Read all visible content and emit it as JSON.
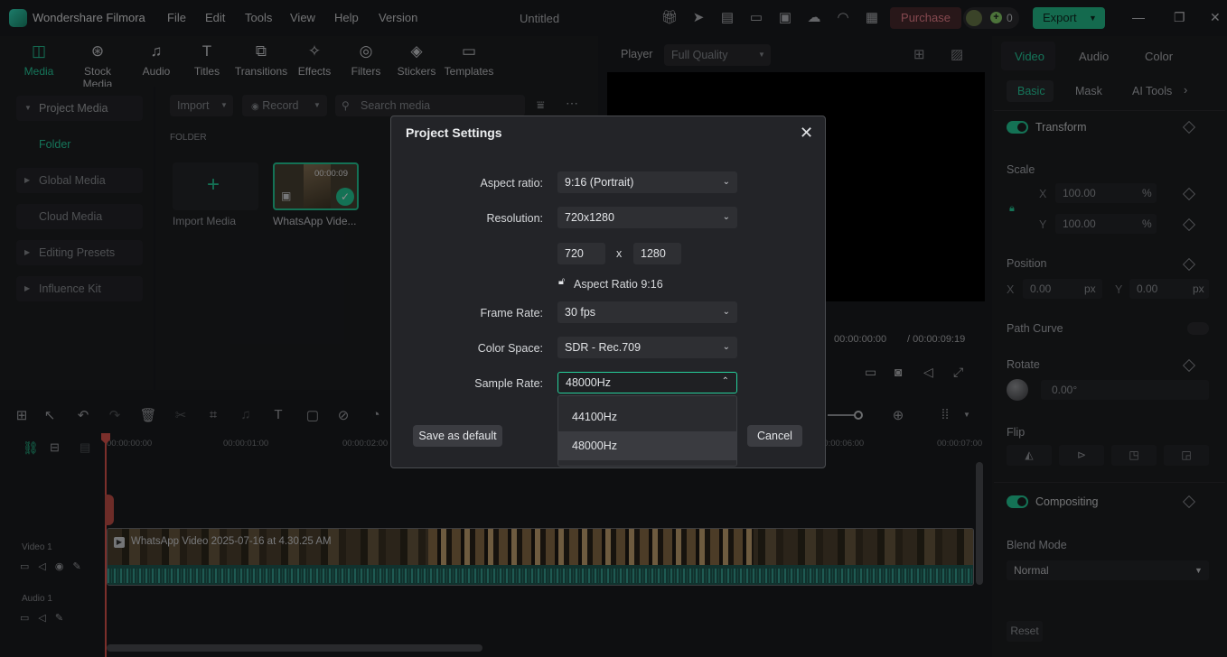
{
  "app": {
    "name": "Wondershare Filmora",
    "project_title": "Untitled"
  },
  "menu": [
    "File",
    "Edit",
    "Tools",
    "View",
    "Help",
    "Version"
  ],
  "header": {
    "purchase_label": "Purchase",
    "credits": "0",
    "export_label": "Export"
  },
  "toptabs": [
    {
      "label": "Media",
      "icon": "media-icon"
    },
    {
      "label": "Stock Media",
      "icon": "stock-media-icon"
    },
    {
      "label": "Audio",
      "icon": "audio-icon"
    },
    {
      "label": "Titles",
      "icon": "titles-icon"
    },
    {
      "label": "Transitions",
      "icon": "transitions-icon"
    },
    {
      "label": "Effects",
      "icon": "effects-icon"
    },
    {
      "label": "Filters",
      "icon": "filters-icon"
    },
    {
      "label": "Stickers",
      "icon": "stickers-icon"
    },
    {
      "label": "Templates",
      "icon": "templates-icon"
    }
  ],
  "sidebar": {
    "items": [
      "Project Media",
      "Folder",
      "Global Media",
      "Cloud Media",
      "Editing Presets",
      "Influence Kit"
    ]
  },
  "media": {
    "import_label": "Import",
    "record_label": "Record",
    "search_placeholder": "Search media",
    "folder_label": "FOLDER",
    "import_media_label": "Import Media",
    "clip_name": "WhatsApp Vide...",
    "clip_duration": "00:00:09"
  },
  "player": {
    "label": "Player",
    "quality": "Full Quality",
    "current_time": "00:00:00:00",
    "total_time": "/ 00:00:09:19"
  },
  "right_panel": {
    "tabs": [
      "Video",
      "Audio",
      "Color"
    ],
    "subtabs": [
      "Basic",
      "Mask",
      "AI Tools"
    ],
    "transform_label": "Transform",
    "scale_label": "Scale",
    "scale_x": "100.00",
    "scale_y": "100.00",
    "pct": "%",
    "x_label": "X",
    "y_label": "Y",
    "position_label": "Position",
    "pos_x": "0.00",
    "pos_y": "0.00",
    "px": "px",
    "path_curve_label": "Path Curve",
    "rotate_label": "Rotate",
    "rotate_value": "0.00°",
    "flip_label": "Flip",
    "compositing_label": "Compositing",
    "blend_mode_label": "Blend Mode",
    "blend_mode_value": "Normal",
    "reset_label": "Reset"
  },
  "timeline": {
    "ruler": [
      "00:00:00:00",
      "00:00:01:00",
      "00:00:02:00",
      "00:00:06:00",
      "00:00:07:00"
    ],
    "video_track_label": "Video 1",
    "audio_track_label": "Audio 1",
    "clip_title": "WhatsApp Video 2025-07-16 at 4.30.25 AM"
  },
  "dialog": {
    "title": "Project Settings",
    "aspect_ratio_label": "Aspect ratio:",
    "aspect_ratio_value": "9:16 (Portrait)",
    "resolution_label": "Resolution:",
    "resolution_value": "720x1280",
    "width": "720",
    "x_sep": "x",
    "height": "1280",
    "aspect_lock_label": "Aspect Ratio 9:16",
    "frame_rate_label": "Frame Rate:",
    "frame_rate_value": "30 fps",
    "color_space_label": "Color Space:",
    "color_space_value": "SDR - Rec.709",
    "sample_rate_label": "Sample Rate:",
    "sample_rate_value": "48000Hz",
    "sample_rate_options": [
      "44100Hz",
      "48000Hz"
    ],
    "save_default_label": "Save as default",
    "cancel_label": "Cancel"
  },
  "colors": {
    "accent": "#26d09b",
    "purchase": "#f0838f",
    "bg": "#1b1c1f"
  }
}
